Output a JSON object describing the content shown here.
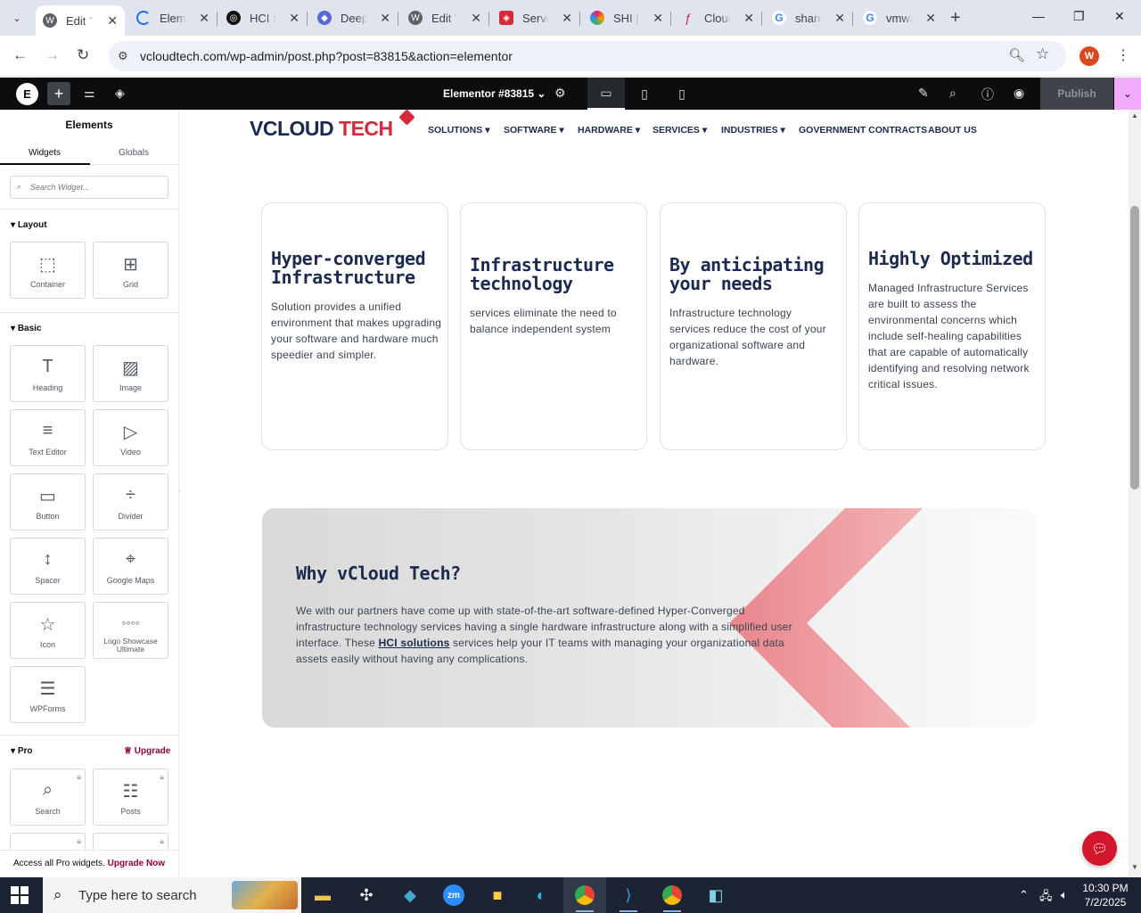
{
  "browser": {
    "tabs": [
      {
        "title": "Edit \"[",
        "active": true
      },
      {
        "title": "Elementor"
      },
      {
        "title": "HCI S"
      },
      {
        "title": "DeepL"
      },
      {
        "title": "Edit \"["
      },
      {
        "title": "Server"
      },
      {
        "title": "SHI |"
      },
      {
        "title": "Cloud"
      },
      {
        "title": "share"
      },
      {
        "title": "vmwa"
      }
    ],
    "url": "vcloudtech.com/wp-admin/post.php?post=83815&action=elementor",
    "profile_initial": "W"
  },
  "elementor": {
    "document_title": "Elementor #83815",
    "publish_label": "Publish"
  },
  "panel": {
    "title": "Elements",
    "tabs": [
      "Widgets",
      "Globals"
    ],
    "search_placeholder": "Search Widget...",
    "sections": {
      "layout": "Layout",
      "basic": "Basic",
      "pro": "Pro"
    },
    "layout_widgets": [
      {
        "label": "Container",
        "icon": "container-icon"
      },
      {
        "label": "Grid",
        "icon": "grid-icon"
      }
    ],
    "basic_widgets": [
      {
        "label": "Heading",
        "icon": "heading-icon"
      },
      {
        "label": "Image",
        "icon": "image-icon"
      },
      {
        "label": "Text Editor",
        "icon": "text-editor-icon"
      },
      {
        "label": "Video",
        "icon": "video-icon"
      },
      {
        "label": "Button",
        "icon": "button-icon"
      },
      {
        "label": "Divider",
        "icon": "divider-icon"
      },
      {
        "label": "Spacer",
        "icon": "spacer-icon"
      },
      {
        "label": "Google Maps",
        "icon": "google-maps-icon"
      },
      {
        "label": "Icon",
        "icon": "star-icon"
      },
      {
        "label": "Logo Showcase Ultimate",
        "icon": "logo-showcase-icon"
      },
      {
        "label": "WPForms",
        "icon": "wpforms-icon"
      }
    ],
    "pro_widgets": [
      {
        "label": "Search",
        "icon": "search-widget-icon"
      },
      {
        "label": "Posts",
        "icon": "posts-icon"
      }
    ],
    "upgrade_label": "Upgrade",
    "pro_footer": {
      "text": "Access all Pro widgets.",
      "link": "Upgrade Now"
    }
  },
  "site": {
    "logo": {
      "part1": "VCLOUD",
      "part2": " TECH"
    },
    "nav": [
      {
        "label": "SOLUTIONS",
        "dropdown": true
      },
      {
        "label": "SOFTWARE",
        "dropdown": true
      },
      {
        "label": "HARDWARE",
        "dropdown": true
      },
      {
        "label": "SERVICES",
        "dropdown": true
      },
      {
        "label": "INDUSTRIES",
        "dropdown": true
      },
      {
        "label": "GOVERNMENT CONTRACTS",
        "dropdown": false
      },
      {
        "label": "ABOUT US",
        "dropdown": false
      }
    ],
    "cards": [
      {
        "title": "Hyper-converged Infrastructure",
        "text": "Solution provides a unified environment that makes upgrading your software and hardware much speedier and simpler."
      },
      {
        "title": "Infrastructure technology",
        "text": "services eliminate the need to balance independent system"
      },
      {
        "title": "By anticipating your needs",
        "text": "Infrastructure technology services reduce the cost of your organizational software and hardware."
      },
      {
        "title": "Highly Optimized",
        "text": "Managed Infrastructure Services are built to assess the environmental concerns which include self-healing capabilities that are capable of automatically identifying and resolving network critical issues."
      }
    ],
    "why": {
      "title": "Why vCloud Tech?",
      "text_before": "We with our partners have come up with state-of-the-art software-defined Hyper-Converged infrastructure technology services having a single hardware infrastructure along with a simplified user interface. These ",
      "link": "HCI solutions",
      "text_after": " services help your IT teams with managing your organizational data assets easily without having any complications."
    }
  },
  "taskbar": {
    "search_placeholder": "Type here to search",
    "time": "10:30 PM",
    "date": "7/2/2025"
  },
  "colors": {
    "brand_navy": "#1b2a4e",
    "brand_red": "#d42b3a",
    "elementor_dark": "#0c0d0e",
    "pro_accent": "#93003f"
  }
}
